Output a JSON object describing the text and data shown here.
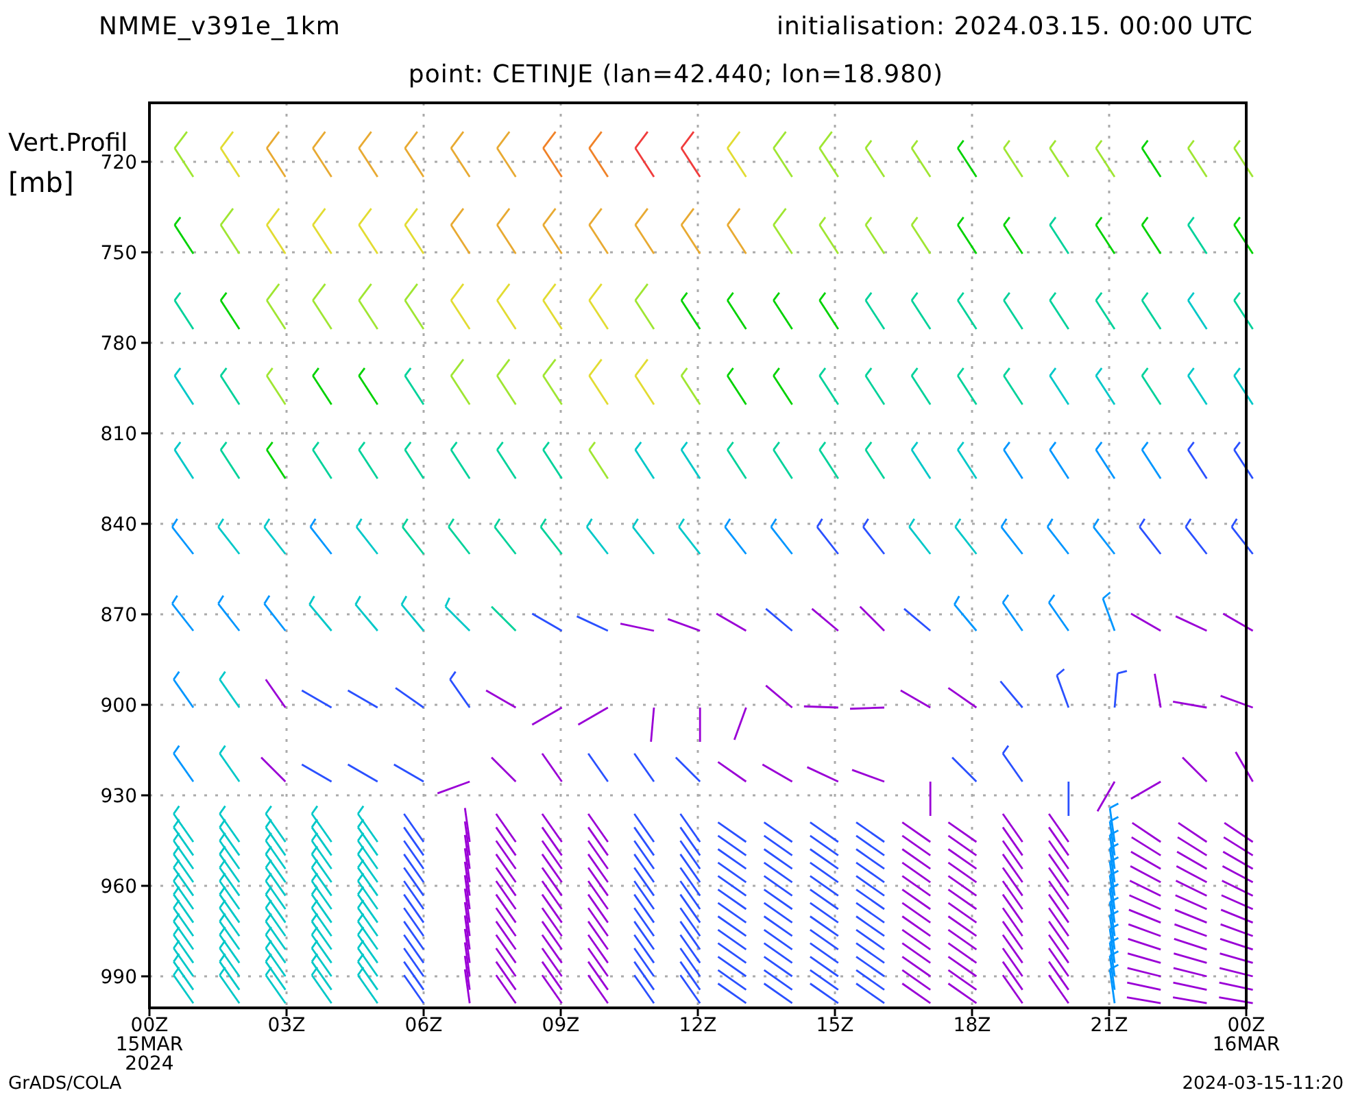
{
  "header": {
    "model": "NMME_v391e_1km",
    "initialisation": "initialisation:  2024.03.15.  00:00  UTC",
    "point": "point:  CETINJE  (lan=42.440;  lon=18.980)"
  },
  "y_axis": {
    "title": "Vert.Profil",
    "unit": "[mb]",
    "ticks": [
      "720",
      "750",
      "780",
      "810",
      "840",
      "870",
      "900",
      "930",
      "960",
      "990"
    ]
  },
  "x_axis": {
    "ticks": [
      {
        "label": "00Z",
        "date": "15MAR",
        "year": "2024"
      },
      {
        "label": "03Z"
      },
      {
        "label": "06Z"
      },
      {
        "label": "09Z"
      },
      {
        "label": "12Z"
      },
      {
        "label": "15Z"
      },
      {
        "label": "18Z"
      },
      {
        "label": "21Z"
      },
      {
        "label": "00Z",
        "date": "16MAR"
      }
    ]
  },
  "footer": {
    "source": "GrADS/COLA",
    "timestamp": "2024-03-15-11:20"
  }
}
